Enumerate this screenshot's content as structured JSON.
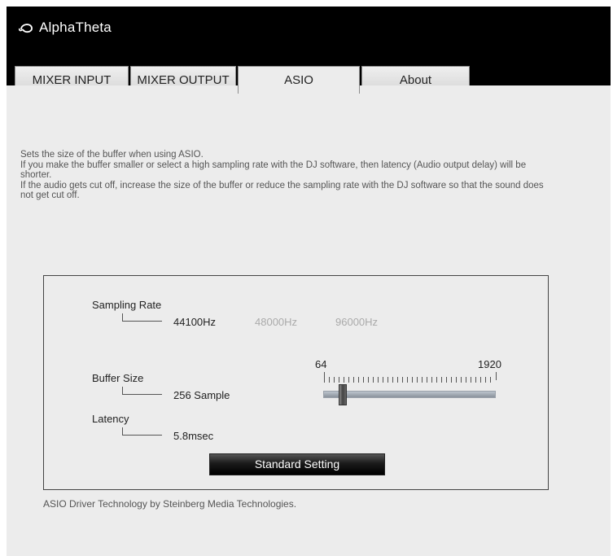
{
  "app": {
    "brand": "AlphaTheta",
    "brand_icon": "alphatheta-logo-icon"
  },
  "tabs": [
    {
      "label": "MIXER INPUT",
      "active": false
    },
    {
      "label": "MIXER OUTPUT",
      "active": false
    },
    {
      "label": "ASIO",
      "active": true
    },
    {
      "label": "About",
      "active": false
    }
  ],
  "description": {
    "line1": "Sets the size of the buffer when using ASIO.",
    "line2": "If you make the buffer smaller or select a high sampling rate with the DJ software, then latency (Audio output delay) will be shorter.",
    "line3": "If the audio gets cut off, increase the size of the buffer or reduce the sampling rate with the DJ software so that the sound does not get cut off."
  },
  "settings": {
    "sampling_rate": {
      "label": "Sampling Rate",
      "options": [
        "44100Hz",
        "48000Hz",
        "96000Hz"
      ],
      "selected": "44100Hz"
    },
    "buffer_size": {
      "label": "Buffer Size",
      "value": "256 Sample",
      "slider_min": "64",
      "slider_max": "1920",
      "slider_value": 256
    },
    "latency": {
      "label": "Latency",
      "value": "5.8msec"
    },
    "standard_button": "Standard Setting"
  },
  "footer": "ASIO Driver Technology by Steinberg Media Technologies.",
  "colors": {
    "window_bg": "#000000",
    "panel_bg": "#ececec",
    "muted_text": "#aaaaaa"
  }
}
